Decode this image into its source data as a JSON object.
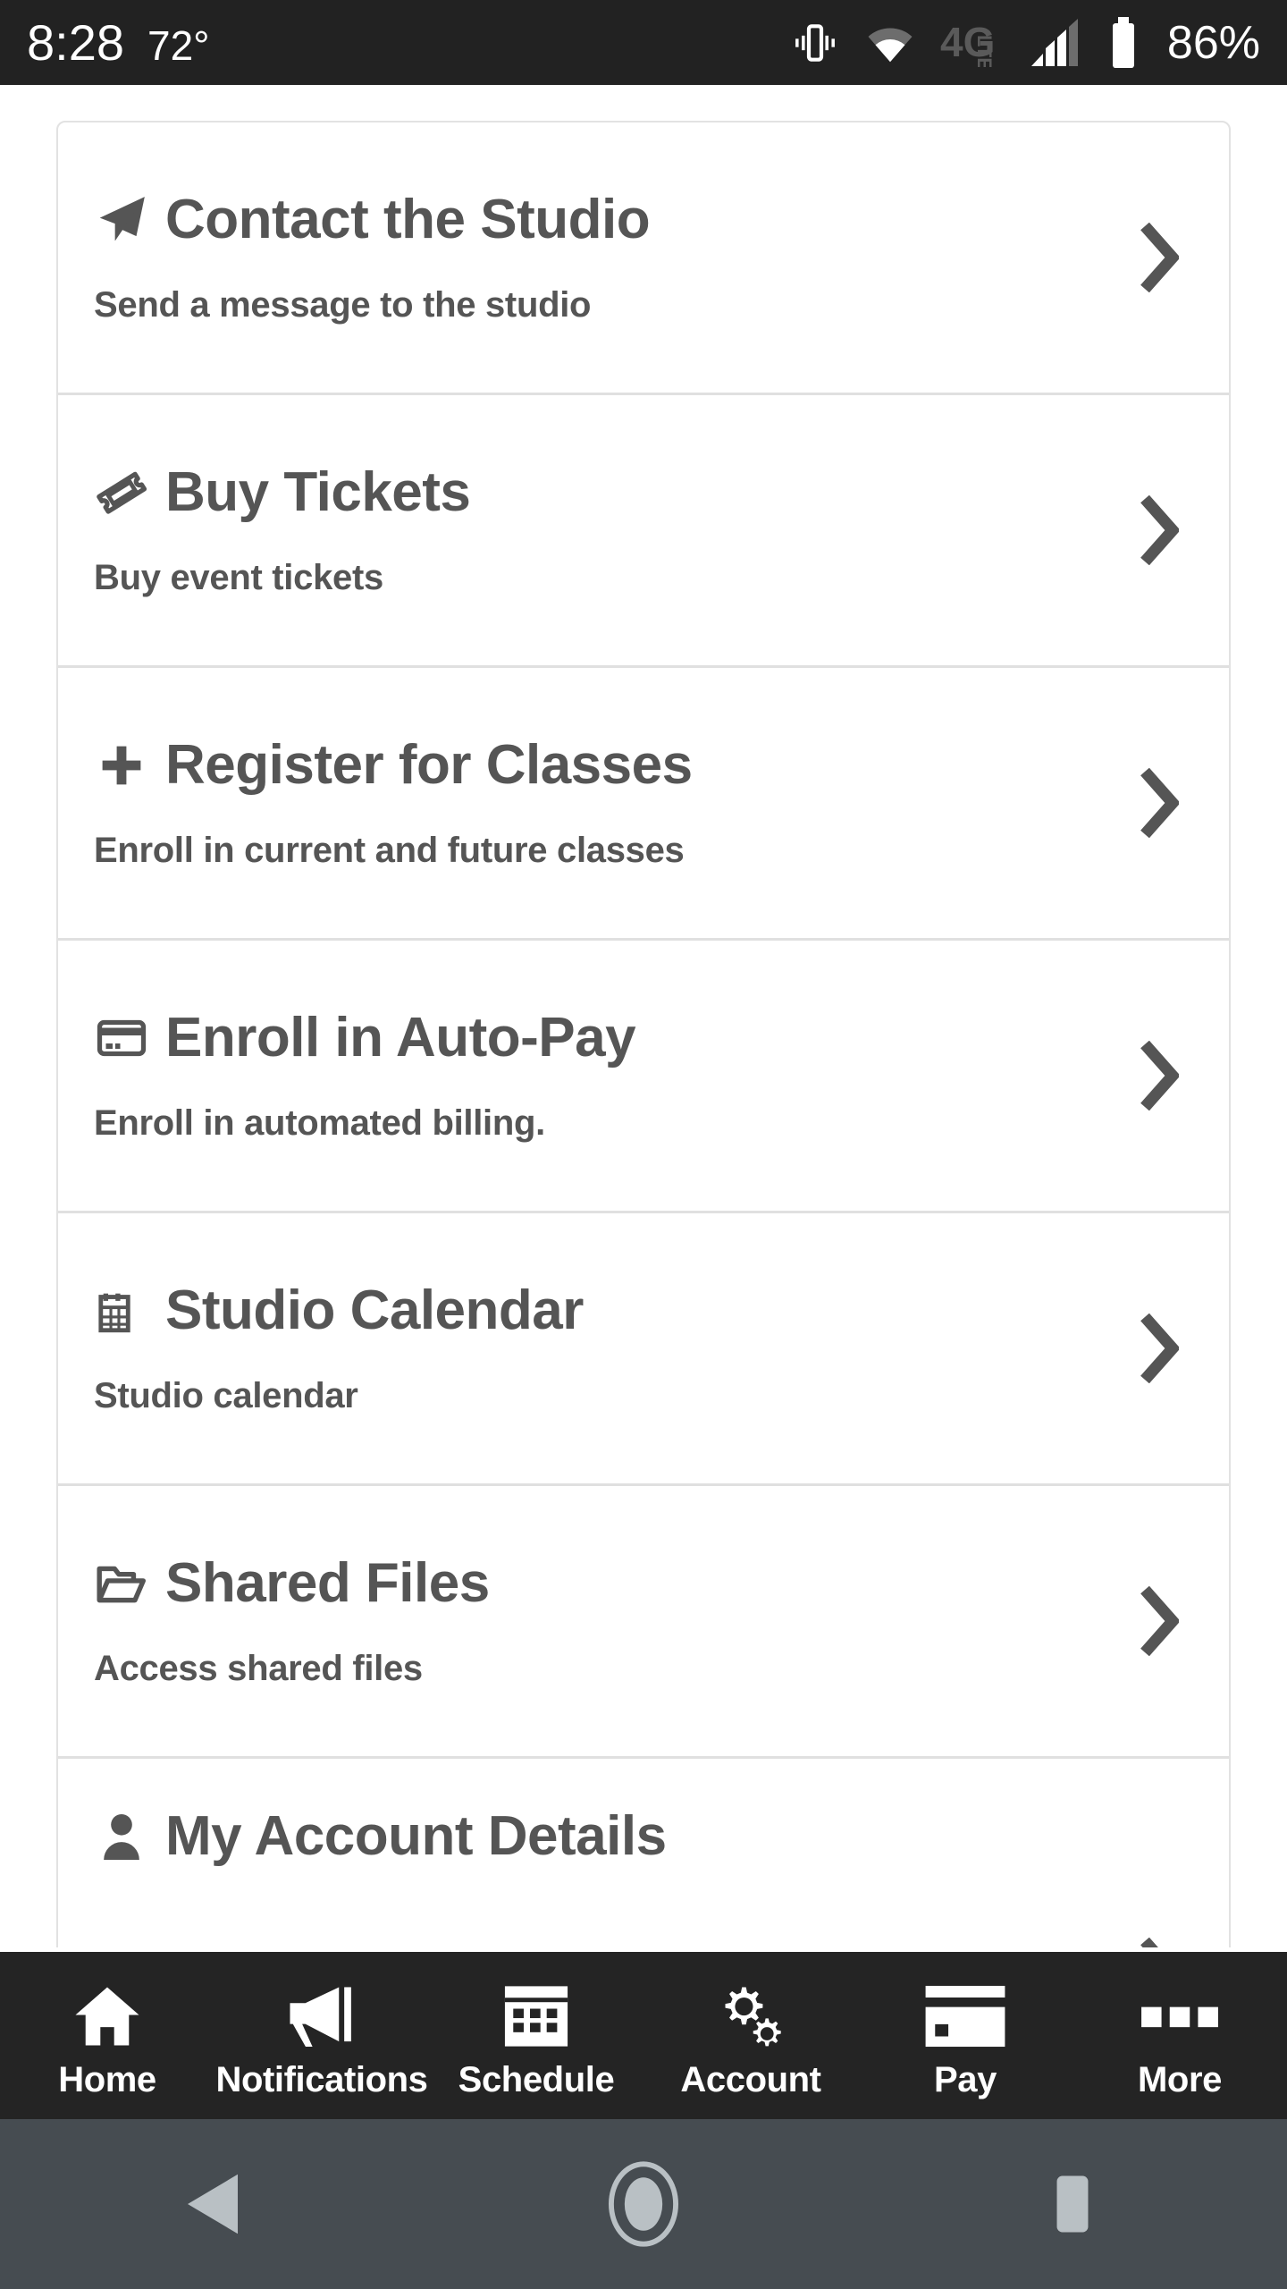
{
  "status_bar": {
    "time": "8:28",
    "temperature": "72°",
    "battery_percent": "86%",
    "icons": [
      "vibrate-icon",
      "wifi-icon",
      "4g-lte-icon",
      "signal-bars-icon",
      "battery-icon"
    ],
    "network_label": "4G",
    "network_sub_label": "LTE",
    "background_color": "#222222",
    "text_color": "#ffffff"
  },
  "menu": {
    "items": [
      {
        "icon": "send-icon",
        "title": "Contact the Studio",
        "subtitle": "Send a message to the studio"
      },
      {
        "icon": "ticket-icon",
        "title": "Buy Tickets",
        "subtitle": "Buy event tickets"
      },
      {
        "icon": "plus-icon",
        "title": "Register for Classes",
        "subtitle": "Enroll in current and future classes"
      },
      {
        "icon": "credit-card-icon",
        "title": "Enroll in Auto-Pay",
        "subtitle": "Enroll in automated billing."
      },
      {
        "icon": "calendar-icon",
        "title": "Studio Calendar",
        "subtitle": "Studio calendar"
      },
      {
        "icon": "folder-open-icon",
        "title": "Shared Files",
        "subtitle": "Access shared files"
      },
      {
        "icon": "person-icon",
        "title": "My Account Details",
        "subtitle": ""
      }
    ],
    "chevron_icon": "chevron-right-icon",
    "text_color": "#555555",
    "divider_color": "#e0e0e0",
    "card_background": "#ffffff"
  },
  "tab_bar": {
    "background_color": "#242424",
    "text_color": "#ffffff",
    "tabs": [
      {
        "icon": "home-icon",
        "label": "Home"
      },
      {
        "icon": "megaphone-icon",
        "label": "Notifications"
      },
      {
        "icon": "calendar-grid-icon",
        "label": "Schedule"
      },
      {
        "icon": "gears-icon",
        "label": "Account"
      },
      {
        "icon": "credit-card-icon",
        "label": "Pay"
      },
      {
        "icon": "more-squares-icon",
        "label": "More"
      }
    ]
  },
  "android_nav": {
    "background_color": "#464c51",
    "buttons": [
      {
        "icon": "back-triangle-icon",
        "name": "back"
      },
      {
        "icon": "home-circle-icon",
        "name": "home"
      },
      {
        "icon": "recents-square-icon",
        "name": "recents"
      }
    ]
  }
}
